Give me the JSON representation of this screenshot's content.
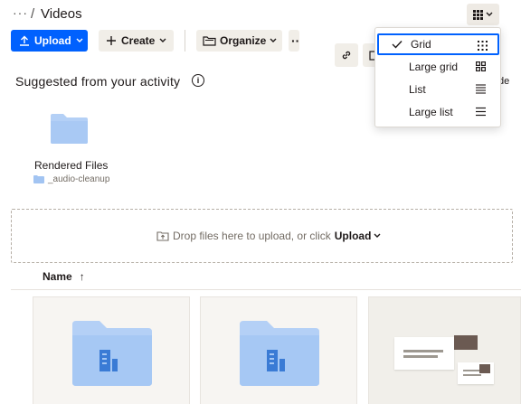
{
  "breadcrumb": {
    "ellipsis": "···",
    "separator": "/",
    "current": "Videos"
  },
  "toolbar": {
    "upload_label": "Upload",
    "create_label": "Create",
    "organize_label": "Organize",
    "more_label": "··"
  },
  "suggested": {
    "heading": "Suggested from your activity",
    "info_glyph": "i",
    "hide_peek": "de",
    "card": {
      "name": "Rendered Files",
      "path": "_audio-cleanup"
    }
  },
  "dropzone": {
    "text": "Drop files here to upload, or click",
    "upload_link": "Upload"
  },
  "file_list": {
    "sort_column": "Name",
    "sort_arrow": "↑"
  },
  "view_menu": {
    "items": [
      {
        "label": "Grid",
        "icon": "grid-dots-icon",
        "selected": true
      },
      {
        "label": "Large grid",
        "icon": "large-grid-icon",
        "selected": false
      },
      {
        "label": "List",
        "icon": "list-icon",
        "selected": false
      },
      {
        "label": "Large list",
        "icon": "large-list-icon",
        "selected": false
      }
    ]
  },
  "colors": {
    "primary": "#0061fe",
    "folder_light": "#b4d0f6",
    "folder_dark": "#a2c4f2",
    "folder_glyph": "#3a7bd5",
    "button_bg": "#f1eee8"
  }
}
